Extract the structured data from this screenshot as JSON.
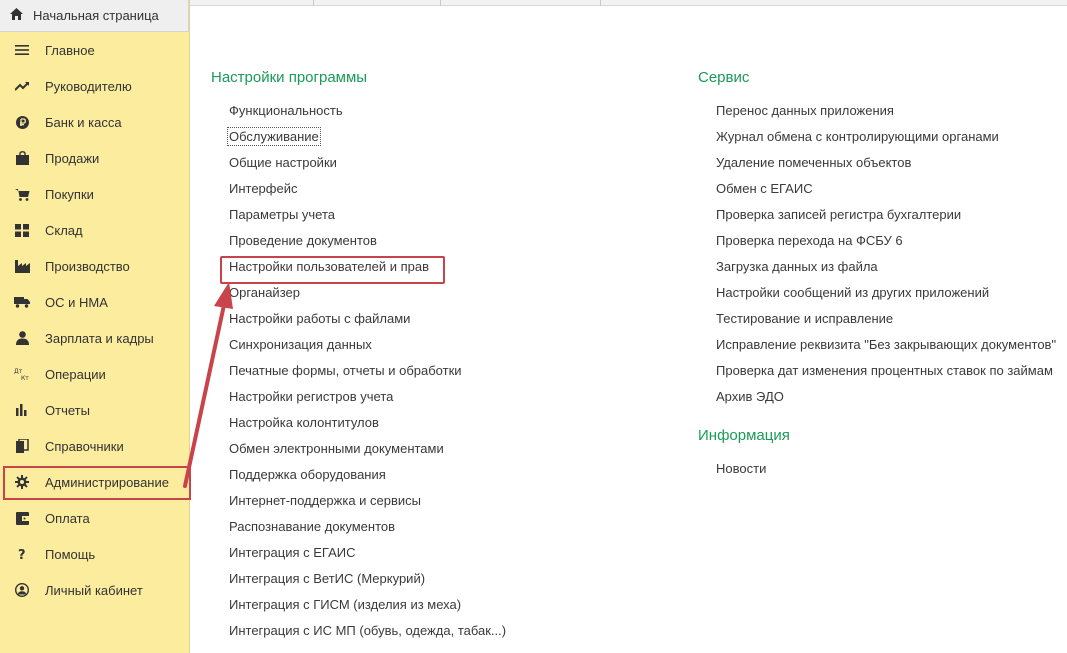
{
  "sidebar": {
    "home": {
      "label": "Начальная страница",
      "icon": "home-icon"
    },
    "items": [
      {
        "label": "Главное",
        "icon": "menu-lines-icon"
      },
      {
        "label": "Руководителю",
        "icon": "trend-icon"
      },
      {
        "label": "Банк и касса",
        "icon": "ruble-coin-icon"
      },
      {
        "label": "Продажи",
        "icon": "shopping-bag-icon"
      },
      {
        "label": "Покупки",
        "icon": "cart-icon"
      },
      {
        "label": "Склад",
        "icon": "warehouse-grid-icon"
      },
      {
        "label": "Производство",
        "icon": "factory-icon"
      },
      {
        "label": "ОС и НМА",
        "icon": "truck-icon"
      },
      {
        "label": "Зарплата и кадры",
        "icon": "person-icon"
      },
      {
        "label": "Операции",
        "icon": "debit-credit-icon"
      },
      {
        "label": "Отчеты",
        "icon": "bar-chart-icon"
      },
      {
        "label": "Справочники",
        "icon": "books-icon"
      },
      {
        "label": "Администрирование",
        "icon": "gear-icon",
        "active": true
      },
      {
        "label": "Оплата",
        "icon": "wallet-icon"
      },
      {
        "label": "Помощь",
        "icon": "question-icon"
      },
      {
        "label": "Личный кабинет",
        "icon": "user-circle-icon"
      }
    ]
  },
  "content": {
    "program_settings": {
      "title": "Настройки программы",
      "links": [
        "Функциональность",
        "Обслуживание",
        "Общие настройки",
        "Интерфейс",
        "Параметры учета",
        "Проведение документов",
        "Настройки пользователей и прав",
        "Органайзер",
        "Настройки работы с файлами",
        "Синхронизация данных",
        "Печатные формы, отчеты и обработки",
        "Настройки регистров учета",
        "Настройка колонтитулов",
        "Обмен электронными документами",
        "Поддержка оборудования",
        "Интернет-поддержка и сервисы",
        "Распознавание документов",
        "Интеграция с ЕГАИС",
        "Интеграция с ВетИС (Меркурий)",
        "Интеграция с ГИСМ (изделия из меха)",
        "Интеграция с ИС МП (обувь, одежда, табак...)"
      ]
    },
    "service": {
      "title": "Сервис",
      "links": [
        "Перенос данных приложения",
        "Журнал обмена с контролирующими органами",
        "Удаление помеченных объектов",
        "Обмен с ЕГАИС",
        "Проверка записей регистра бухгалтерии",
        "Проверка перехода на ФСБУ 6",
        "Загрузка данных из файла",
        "Настройки сообщений из других приложений",
        "Тестирование и исправление",
        "Исправление реквизита \"Без закрывающих документов\"",
        "Проверка дат изменения процентных ставок по займам",
        "Архив ЭДО"
      ]
    },
    "info": {
      "title": "Информация",
      "links": [
        "Новости"
      ]
    }
  },
  "colors": {
    "sidebar_bg": "#fbec9e",
    "section_title": "#1a9b57",
    "highlight": "#c9444a"
  }
}
